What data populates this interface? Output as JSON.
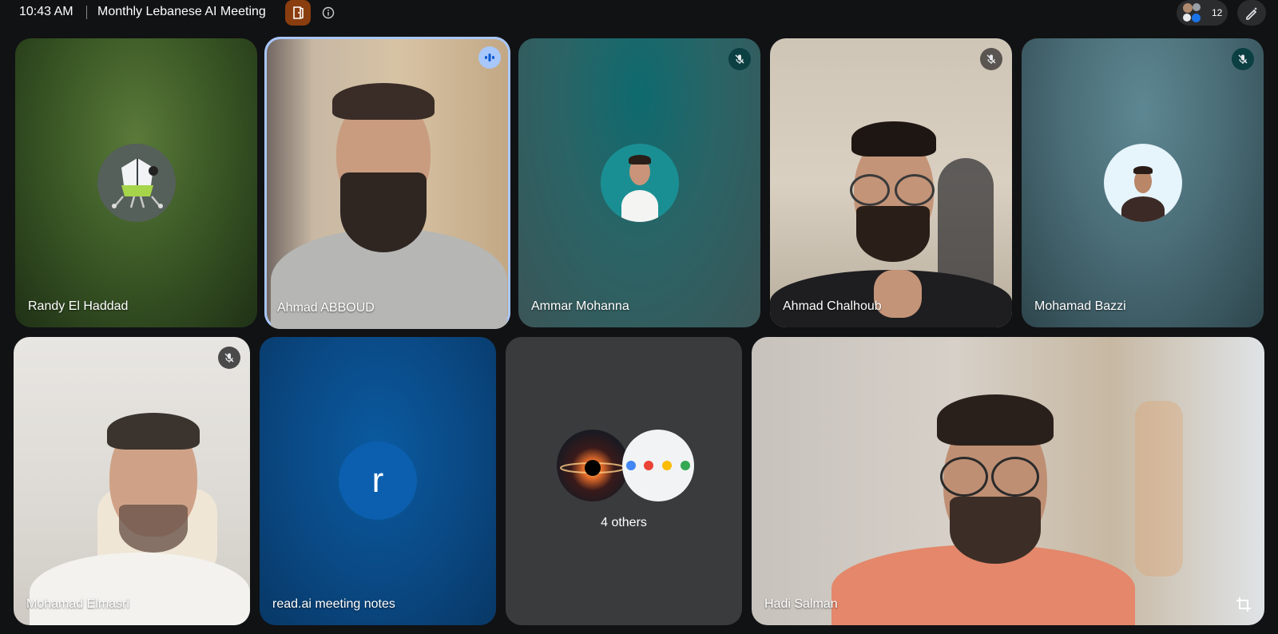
{
  "header": {
    "time": "10:43 AM",
    "meeting_title": "Monthly Lebanese AI Meeting",
    "participant_count": "12"
  },
  "tiles": [
    {
      "name": "Randy El Haddad",
      "state": "avatar",
      "muted": false
    },
    {
      "name": "Ahmad ABBOUD",
      "state": "video",
      "speaking": true
    },
    {
      "name": "Ammar Mohanna",
      "state": "avatar",
      "muted": true
    },
    {
      "name": "Ahmad Chalhoub",
      "state": "video",
      "muted": true
    },
    {
      "name": "Mohamad Bazzi",
      "state": "avatar",
      "muted": true
    },
    {
      "name": "Mohamad Elmasri",
      "state": "video",
      "muted": true
    },
    {
      "name": "read.ai meeting notes",
      "state": "avatar",
      "initial": "r"
    },
    {
      "name": "4 others",
      "state": "group"
    },
    {
      "name": "Hadi Salman",
      "state": "video"
    }
  ],
  "colors": {
    "speaking_border": "#a8c7fa",
    "door_button": "#8a3d0e",
    "background": "#111214"
  }
}
